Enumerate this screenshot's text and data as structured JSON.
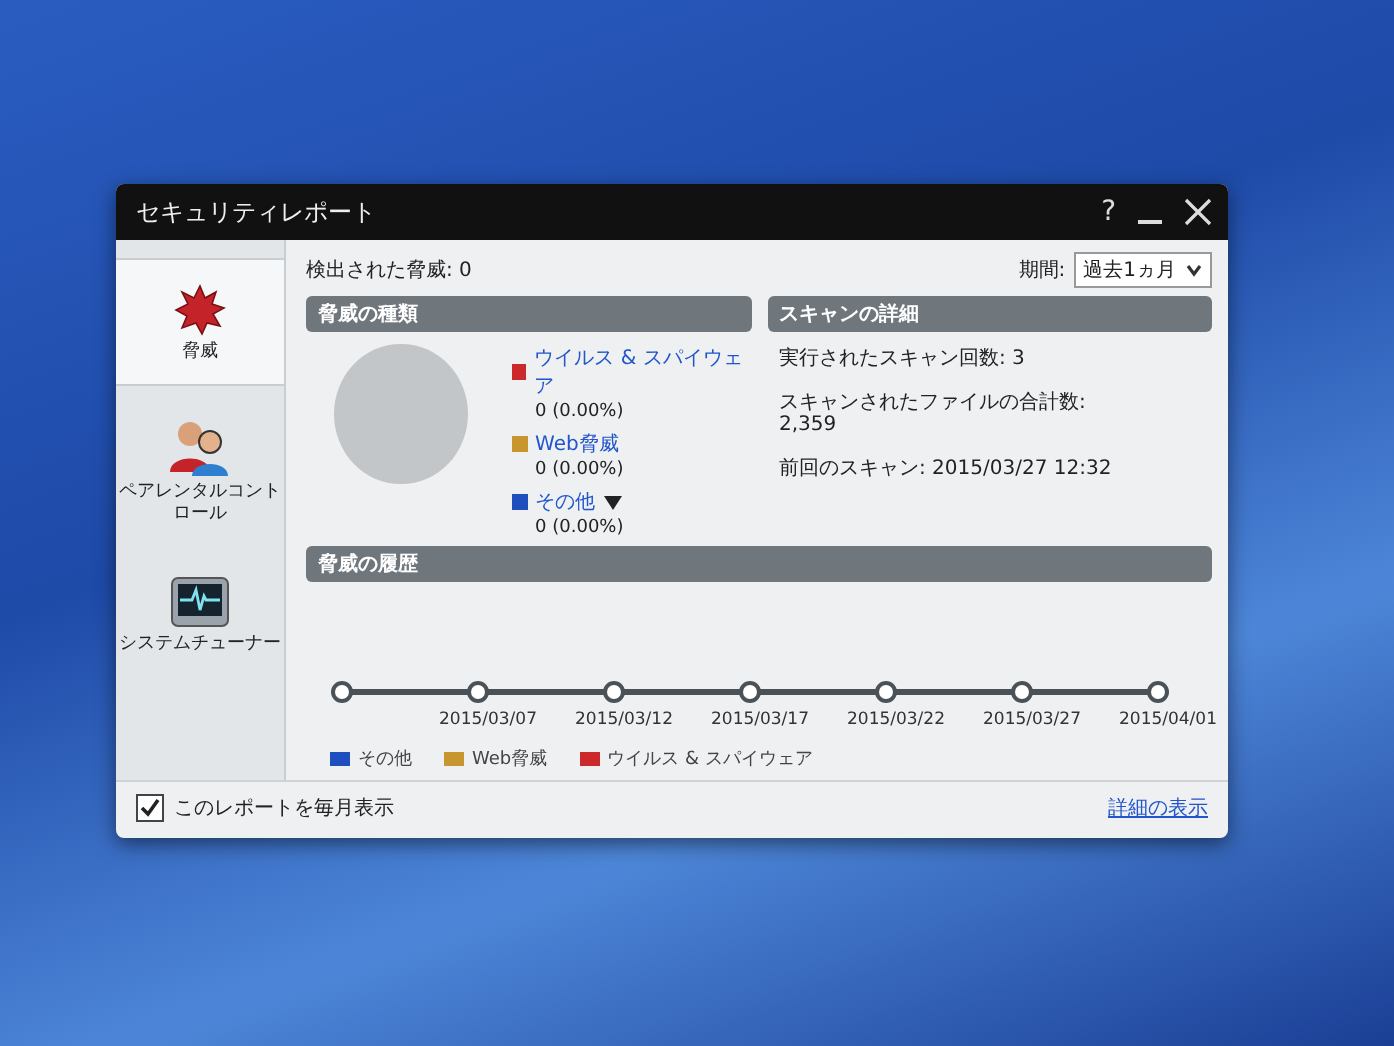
{
  "window": {
    "title": "セキュリティレポート",
    "controls": [
      "?"
    ]
  },
  "sidebar": {
    "items": [
      {
        "kind": "threat",
        "label": "脅威",
        "selected": true
      },
      {
        "kind": "parental",
        "label": "ペアレンタルコントロール",
        "selected": false
      },
      {
        "kind": "tuner",
        "label": "システムチューナー",
        "selected": false
      }
    ]
  },
  "summary": {
    "detected": "検出された脅威: 0",
    "period_label": "期間:",
    "period_value": "過去1ヵ月"
  },
  "threat_types": {
    "heading": "脅威の種類",
    "legend": [
      {
        "label": "ウイルス & スパイウェア",
        "count": "0 (0.00%)",
        "color": "#cc2a2a",
        "menu": false
      },
      {
        "label": "Web脅威",
        "count": "0 (0.00%)",
        "color": "#c8962e",
        "menu": false
      },
      {
        "label": "その他",
        "count": "0 (0.00%)",
        "color": "#1f4fbf",
        "menu": true
      }
    ]
  },
  "scan_details": {
    "heading": "スキャンの詳細",
    "lines": [
      "実行されたスキャン回数: 3",
      "スキャンされたファイルの合計数:\n2,359",
      "前回のスキャン: 2015/03/27 12:32"
    ]
  },
  "history": {
    "heading": "脅威の履歴",
    "dates": [
      "2015/03/07",
      "2015/03/12",
      "2015/03/17",
      "2015/03/22",
      "2015/03/27",
      "2015/04/01"
    ],
    "legend": [
      {
        "label": "その他",
        "color": "#1f4fbf"
      },
      {
        "label": "Web脅威",
        "color": "#c8962e"
      },
      {
        "label": "ウイルス & スパイウェア",
        "color": "#cc2a2a"
      }
    ]
  },
  "footer": {
    "checkbox_label": "このレポートを毎月表示",
    "checked": true,
    "link": "詳細の表示"
  }
}
